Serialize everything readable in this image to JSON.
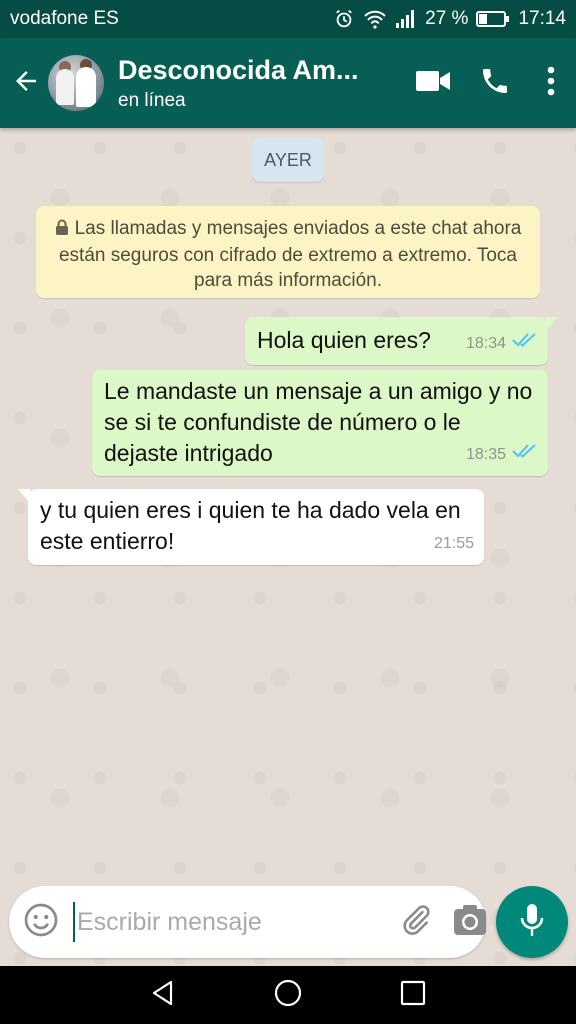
{
  "status_bar": {
    "carrier": "vodafone ES",
    "battery": "27 %",
    "time": "17:14"
  },
  "header": {
    "contact_name": "Desconocida Am...",
    "status": "en línea"
  },
  "chat": {
    "date_chip": "AYER",
    "encryption_notice": "Las llamadas y mensajes enviados a este chat ahora están seguros con cifrado de extremo a extremo. Toca para más información.",
    "messages": [
      {
        "direction": "out",
        "text": "Hola quien eres?",
        "time": "18:34",
        "status": "read"
      },
      {
        "direction": "out",
        "text": "Le mandaste un mensaje a un amigo y no se si te confundiste de número o le dejaste intrigado",
        "time": "18:35",
        "status": "read"
      },
      {
        "direction": "in",
        "text": "y tu quien eres i quien te ha dado vela en este entierro!",
        "time": "21:55"
      }
    ]
  },
  "composer": {
    "placeholder": "Escribir mensaje"
  },
  "colors": {
    "header": "#075e54",
    "status_bar": "#054d44",
    "outgoing_bubble": "#dcf8c6",
    "incoming_bubble": "#ffffff",
    "read_ticks": "#4fc3f7",
    "mic_button": "#00897b"
  },
  "icons": [
    "back-arrow-icon",
    "video-call-icon",
    "phone-icon",
    "more-vert-icon",
    "lock-icon",
    "double-check-icon",
    "emoji-icon",
    "attach-icon",
    "camera-icon",
    "mic-icon",
    "nav-back-icon",
    "nav-home-icon",
    "nav-recents-icon"
  ]
}
